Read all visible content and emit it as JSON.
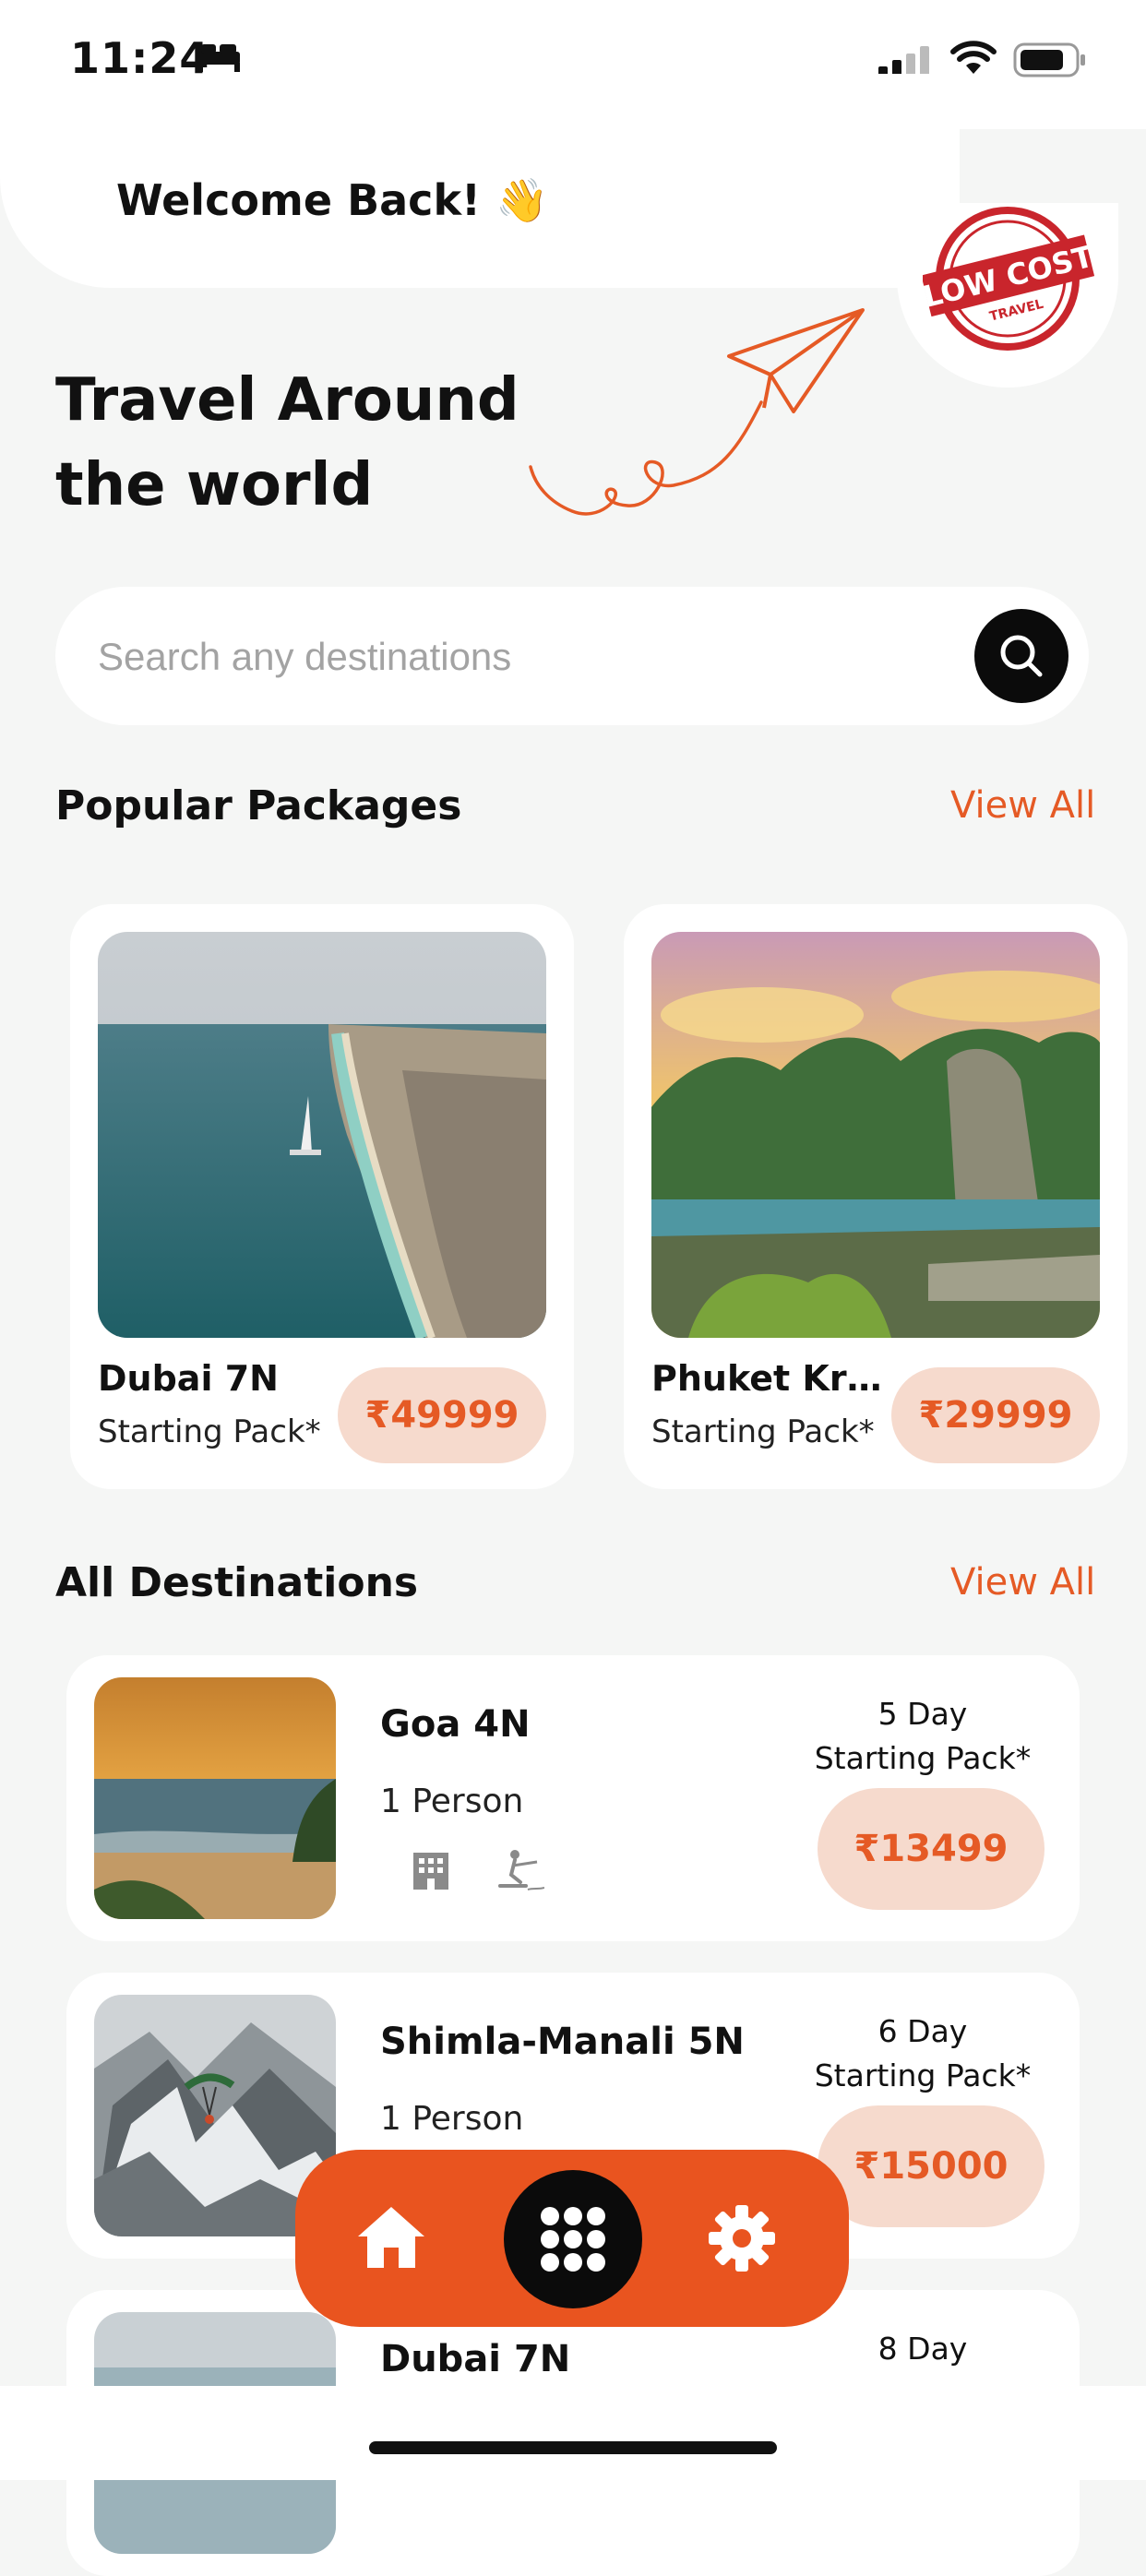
{
  "status": {
    "time": "11:24"
  },
  "header": {
    "welcome": "Welcome Back! 👋",
    "stamp_line1": "LOW COST",
    "stamp_line2": "TRAVEL"
  },
  "hero": {
    "title": "Travel Around the world"
  },
  "search": {
    "placeholder": "Search any destinations"
  },
  "popular": {
    "title": "Popular Packages",
    "view_all": "View All",
    "items": [
      {
        "name": "Dubai 7N",
        "sub": "Starting Pack*",
        "price": "₹49999"
      },
      {
        "name": "Phuket Krabi...",
        "sub": "Starting Pack*",
        "price": "₹29999"
      }
    ]
  },
  "destinations": {
    "title": "All Destinations",
    "view_all": "View All",
    "items": [
      {
        "name": "Goa 4N",
        "person": "1 Person",
        "days": "5 Day",
        "pack": "Starting Pack*",
        "price": "₹13499"
      },
      {
        "name": "Shimla-Manali 5N",
        "person": "1 Person",
        "days": "6 Day",
        "pack": "Starting Pack*",
        "price": "₹15000"
      },
      {
        "name": "Dubai 7N",
        "person": "",
        "days": "8 Day",
        "pack": "",
        "price": ""
      }
    ]
  },
  "nav": {
    "items": [
      "home-icon",
      "grid-menu-icon",
      "settings-icon"
    ],
    "accent": "#e9541f"
  },
  "colors": {
    "accent": "#e55a25",
    "price_bg": "#f6dacd",
    "background": "#f5f6f5"
  }
}
